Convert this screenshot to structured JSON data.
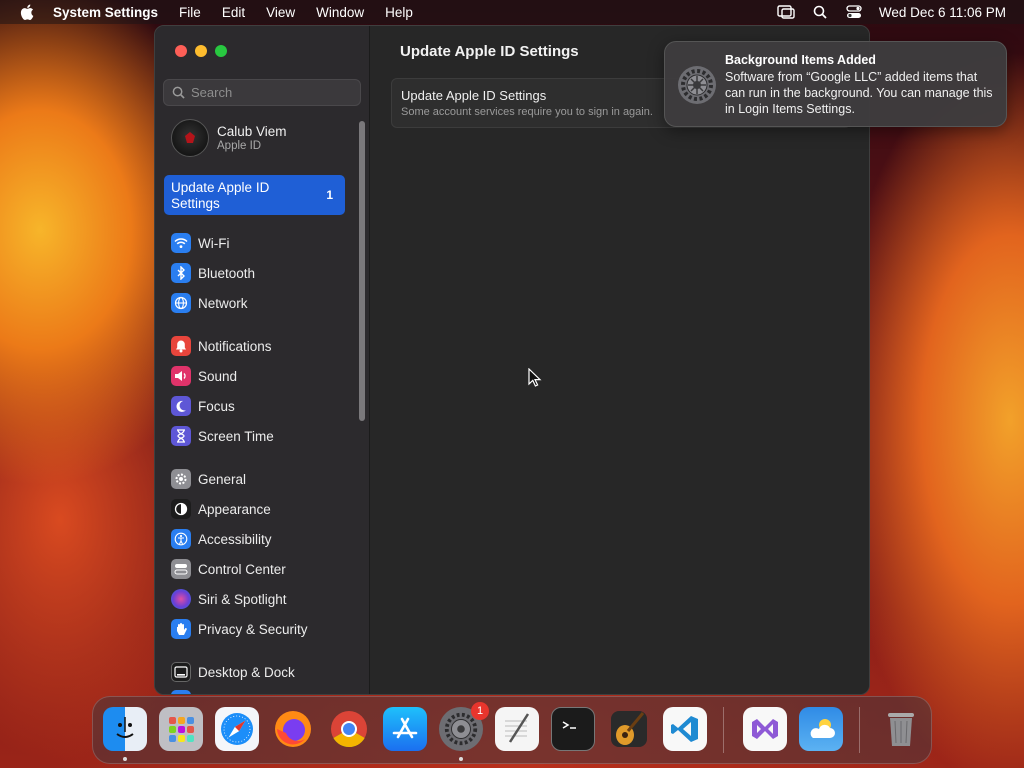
{
  "menubar": {
    "app_name": "System Settings",
    "menus": [
      "File",
      "Edit",
      "View",
      "Window",
      "Help"
    ],
    "clock": "Wed Dec 6  11:06 PM"
  },
  "window": {
    "search_placeholder": "Search",
    "account": {
      "name": "Calub Viem",
      "subtitle": "Apple ID"
    },
    "selected_item": {
      "label_line1": "Update Apple ID",
      "label_line2": "Settings",
      "badge": "1"
    },
    "sidebar_items": [
      {
        "label": "Wi-Fi",
        "icon": "wifi-icon",
        "color": "#2a7ef0"
      },
      {
        "label": "Bluetooth",
        "icon": "bluetooth-icon",
        "color": "#2a7ef0"
      },
      {
        "label": "Network",
        "icon": "globe-icon",
        "color": "#2a7ef0"
      },
      {
        "label": "Notifications",
        "icon": "bell-icon",
        "color": "#e8453c"
      },
      {
        "label": "Sound",
        "icon": "speaker-icon",
        "color": "#e0336a"
      },
      {
        "label": "Focus",
        "icon": "moon-icon",
        "color": "#5e57d6"
      },
      {
        "label": "Screen Time",
        "icon": "hourglass-icon",
        "color": "#5e57d6"
      },
      {
        "label": "General",
        "icon": "gear-icon",
        "color": "#8e8e93"
      },
      {
        "label": "Appearance",
        "icon": "appearance-icon",
        "color": "#1c1c1c"
      },
      {
        "label": "Accessibility",
        "icon": "accessibility-icon",
        "color": "#2a7ef0"
      },
      {
        "label": "Control Center",
        "icon": "control-center-icon",
        "color": "#8e8e93"
      },
      {
        "label": "Siri & Spotlight",
        "icon": "siri-icon",
        "color": "#7b3fc4"
      },
      {
        "label": "Privacy & Security",
        "icon": "hand-icon",
        "color": "#2a7ef0"
      },
      {
        "label": "Desktop & Dock",
        "icon": "dock-icon",
        "color": "#1c1c1c"
      }
    ]
  },
  "main": {
    "title": "Update Apple ID Settings",
    "card": {
      "title": "Update Apple ID Settings",
      "subtitle": "Some account services require you to sign in again."
    }
  },
  "notification": {
    "title": "Background Items Added",
    "body": "Software from “Google LLC” added items that can run in the background. You can manage this in Login Items Settings."
  },
  "dock": {
    "apps": [
      "Finder",
      "Launchpad",
      "Safari",
      "Firefox",
      "Chrome",
      "App Store",
      "System Settings",
      "TextEdit",
      "Terminal",
      "GarageBand",
      "Visual Studio Code",
      "Visual Studio",
      "Weather",
      "Trash"
    ],
    "system_settings_badge": "1"
  }
}
